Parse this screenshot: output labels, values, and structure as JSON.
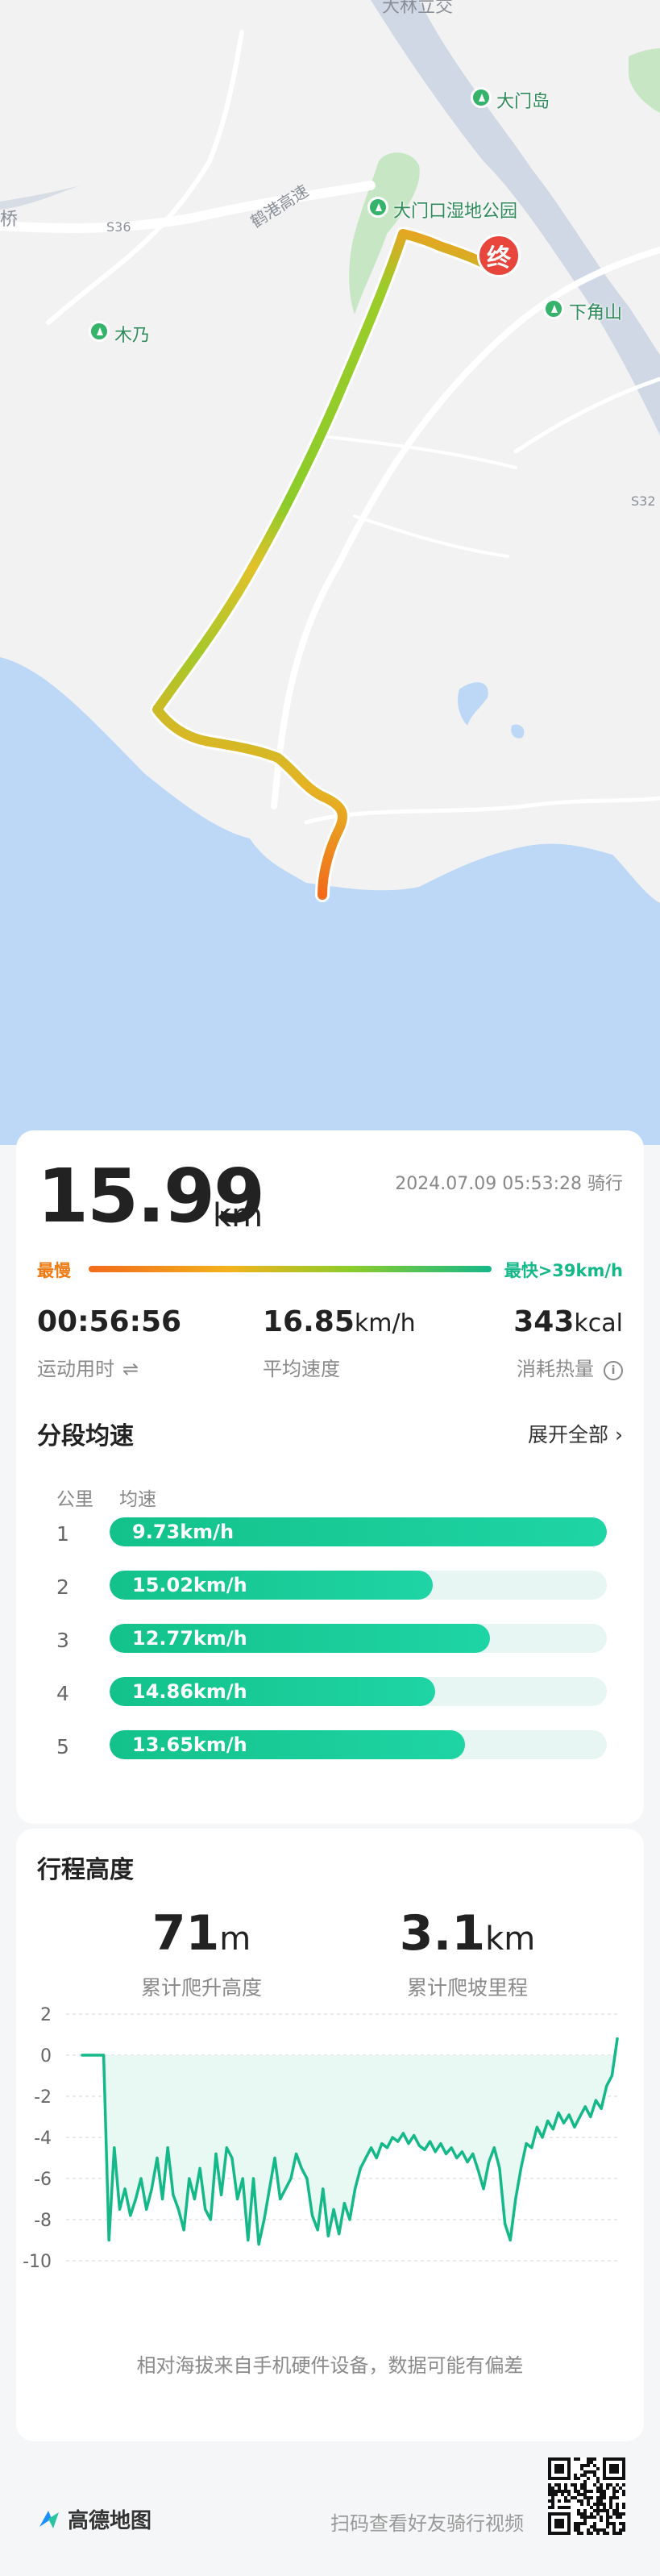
{
  "map": {
    "top_label": "大林立交",
    "road_label": "鹤港高速",
    "road_code_left": "S36",
    "road_code_right": "S32",
    "edge_label": "桥",
    "pois": [
      "大门岛",
      "大门口湿地公园",
      "下角山",
      "木乃"
    ],
    "end_marker": "终",
    "colors": {
      "water": "#bcd8f6",
      "land": "#f2f2f2",
      "park": "#c7e6c4",
      "road": "#ffffff"
    }
  },
  "summary": {
    "distance_value": "15.99",
    "distance_unit": "km",
    "datetime": "2024.07.09 05:53:28 骑行",
    "slowest_label": "最慢",
    "fastest_label": "最快>39km/h"
  },
  "stats": [
    {
      "value": "00:56:56",
      "unit": "",
      "label": "运动用时"
    },
    {
      "value": "16.85",
      "unit": "km/h",
      "label": "平均速度"
    },
    {
      "value": "343",
      "unit": "kcal",
      "label": "消耗热量"
    }
  ],
  "segments": {
    "title": "分段均速",
    "expand_label": "展开全部",
    "col_km": "公里",
    "col_speed": "均速",
    "rows": [
      {
        "index": "1",
        "speed": "9.73km/h",
        "fill": 1.0
      },
      {
        "index": "2",
        "speed": "15.02km/h",
        "fill": 0.65
      },
      {
        "index": "3",
        "speed": "12.77km/h",
        "fill": 0.765
      },
      {
        "index": "4",
        "speed": "14.86km/h",
        "fill": 0.655
      },
      {
        "index": "5",
        "speed": "13.65km/h",
        "fill": 0.715
      }
    ]
  },
  "elevation": {
    "title": "行程高度",
    "climb_value": "71",
    "climb_unit": "m",
    "climb_label": "累计爬升高度",
    "slope_value": "3.1",
    "slope_unit": "km",
    "slope_label": "累计爬坡里程",
    "disclaimer": "相对海拔来自手机硬件设备，数据可能有偏差"
  },
  "chart_data": {
    "type": "line",
    "title": "",
    "xlabel": "",
    "ylabel": "",
    "ylim": [
      -10,
      2
    ],
    "yticks": [
      2,
      0,
      -2,
      -4,
      -6,
      -8,
      -10
    ],
    "grid": true,
    "color": "#14b889",
    "values": [
      0,
      0,
      0,
      0,
      0,
      -9,
      -4.5,
      -7.5,
      -6.5,
      -7.8,
      -7,
      -6,
      -7.5,
      -6.5,
      -5,
      -7,
      -4.5,
      -6.8,
      -7.5,
      -8.5,
      -6,
      -7,
      -5.5,
      -7.5,
      -8,
      -4.8,
      -6.8,
      -4.5,
      -5,
      -7,
      -6,
      -9,
      -6,
      -9.2,
      -8,
      -6.5,
      -5,
      -7,
      -6.5,
      -6,
      -4.8,
      -5.5,
      -6,
      -7.8,
      -8.5,
      -6.5,
      -8.8,
      -7.5,
      -8.7,
      -7.2,
      -8,
      -6.5,
      -5.5,
      -5,
      -4.5,
      -5,
      -4.3,
      -4.5,
      -4,
      -4.2,
      -3.8,
      -4.3,
      -3.9,
      -4.4,
      -4.6,
      -4.2,
      -4.7,
      -4.3,
      -4.8,
      -4.5,
      -5,
      -4.7,
      -5.2,
      -4.8,
      -5.6,
      -6.5,
      -5.2,
      -4.5,
      -5.5,
      -8.2,
      -9,
      -7,
      -5.5,
      -4.3,
      -4.5,
      -3.5,
      -4,
      -3.2,
      -3.6,
      -2.8,
      -3.3,
      -2.9,
      -3.5,
      -3,
      -2.5,
      -3,
      -2.2,
      -2.6,
      -1.5,
      -1,
      0.8
    ]
  },
  "footer": {
    "brand": "高德地图",
    "hint": "扫码查看好友骑行视频"
  }
}
